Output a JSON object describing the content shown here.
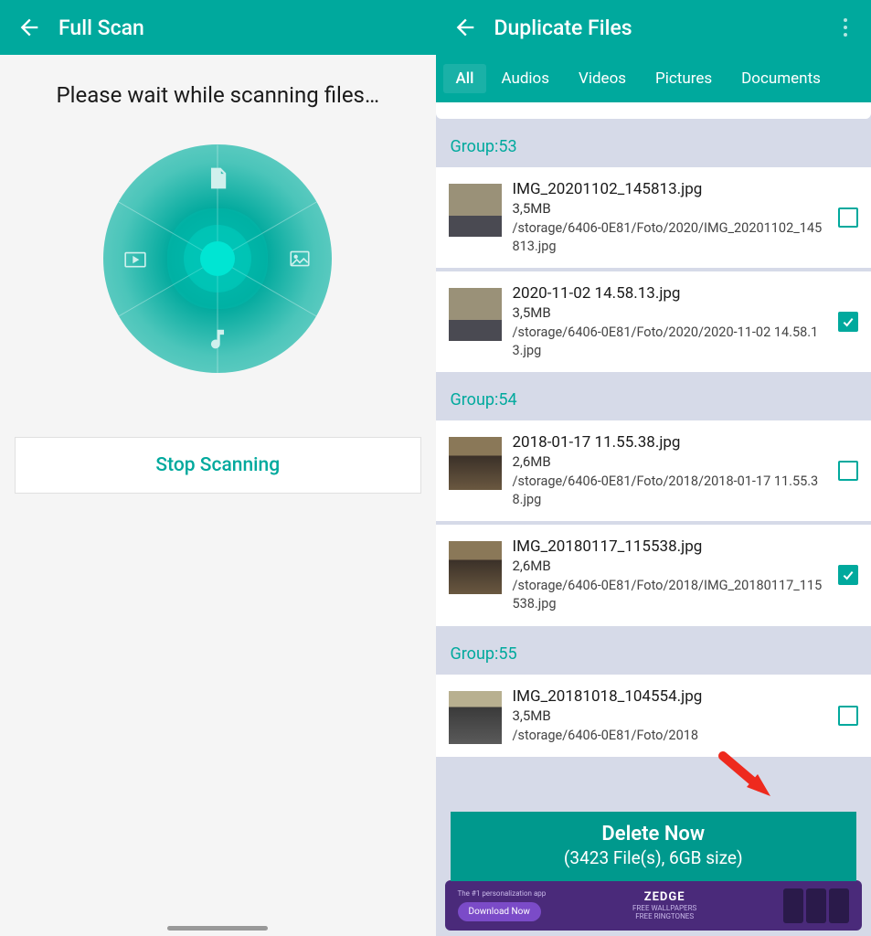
{
  "left": {
    "title": "Full Scan",
    "message": "Please wait while scanning files…",
    "stop_button": "Stop Scanning"
  },
  "right": {
    "title": "Duplicate Files",
    "tabs": [
      "All",
      "Audios",
      "Videos",
      "Pictures",
      "Documents"
    ],
    "active_tab": 0,
    "groups": [
      {
        "label": "Group:53",
        "files": [
          {
            "name": "IMG_20201102_145813.jpg",
            "size": "3,5MB",
            "path": "/storage/6406-0E81/Foto/2020/IMG_20201102_145813.jpg",
            "checked": false
          },
          {
            "name": "2020-11-02 14.58.13.jpg",
            "size": "3,5MB",
            "path": "/storage/6406-0E81/Foto/2020/2020-11-02 14.58.13.jpg",
            "checked": true
          }
        ]
      },
      {
        "label": "Group:54",
        "files": [
          {
            "name": "2018-01-17 11.55.38.jpg",
            "size": "2,6MB",
            "path": "/storage/6406-0E81/Foto/2018/2018-01-17 11.55.38.jpg",
            "checked": false
          },
          {
            "name": "IMG_20180117_115538.jpg",
            "size": "2,6MB",
            "path": "/storage/6406-0E81/Foto/2018/IMG_20180117_115538.jpg",
            "checked": true
          }
        ]
      },
      {
        "label": "Group:55",
        "files": [
          {
            "name": "IMG_20181018_104554.jpg",
            "size": "3,5MB",
            "path": "/storage/6406-0E81/Foto/2018",
            "checked": false
          }
        ]
      }
    ],
    "delete": {
      "title": "Delete Now",
      "subtitle": "(3423 File(s), 6GB size)"
    },
    "ad": {
      "tag": "The #1 personalization app",
      "download": "Download Now",
      "brand": "ZEDGE",
      "line1": "FREE WALLPAPERS",
      "line2": "FREE RINGTONES"
    }
  }
}
